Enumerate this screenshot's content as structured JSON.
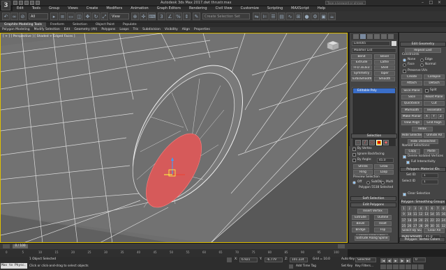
{
  "title": {
    "text": "Autodesk 3ds Max 2017.dwt  thrustr.max",
    "search_placeholder": "Type a keyword or phrase"
  },
  "menu": [
    "Edit",
    "Tools",
    "Group",
    "Views",
    "Create",
    "Modifiers",
    "Animation",
    "Graph Editors",
    "Rendering",
    "Civil View",
    "Customize",
    "Scripting",
    "MAXScript",
    "Help"
  ],
  "toolbar": {
    "selection_filter": "All",
    "reference_coord": "View",
    "named_selection": "Create Selection Set"
  },
  "ribbon_tabs": [
    "Graphite Modeling Tools",
    "Freeform",
    "Selection",
    "Object Paint",
    "Populate"
  ],
  "ribbon_items": [
    "Polygon Modeling",
    "Modify Selection",
    "Edit",
    "Geometry (All)",
    "Polygons",
    "Loops",
    "Tris",
    "Subdivision",
    "Visibility",
    "Align",
    "Properties"
  ],
  "viewport": {
    "label": "[ + ] [ Perspective ] [ Shaded + Edged Faces ]"
  },
  "command_panel": {
    "object_name": "Line005",
    "modifier_list": "Modifier List",
    "modifier_buttons": [
      "Bend",
      "Bevel",
      "Extrude",
      "Lathe",
      "FFD 3x3x3",
      "Shell",
      "Symmetry",
      "Taper",
      "TurboSmooth",
      "Smooth"
    ],
    "stack_item": "Editable Poly",
    "selection_header": "Selection",
    "by_vertex": "By Vertex",
    "ignore_backfacing": "Ignore Backfacing",
    "by_angle": "By Angle:",
    "angle_value": "45.0",
    "shrink": "Shrink",
    "grow": "Grow",
    "ring": "Ring",
    "loop": "Loop",
    "preview_selection": "Preview Selection",
    "preview_off": "Off",
    "preview_subobj": "SubObj",
    "preview_multi": "Multi",
    "selected_count": "Polygon 5538 Selected",
    "soft_selection": "Soft Selection",
    "edit_polygons": "Edit Polygons",
    "insert_vertex": "Insert Vertex",
    "extrude": "Extrude",
    "outline": "Outline",
    "bevel": "Bevel",
    "inset": "Inset",
    "bridge": "Bridge",
    "flip": "Flip",
    "hinge_from_edge": "Hinge From Edge",
    "extrude_along_spline": "Extrude Along Spline",
    "edit_triangulation": "Edit Triangulation",
    "retriangulate": "Retriangulate",
    "turn": "Turn"
  },
  "edit_geometry": {
    "header": "Edit Geometry",
    "repeat_last": "Repeat Last",
    "constraints": "Constraints",
    "none": "None",
    "edge": "Edge",
    "face": "Face",
    "normal": "Normal",
    "preserve_uvs": "Preserve UVs",
    "create": "Create",
    "collapse": "Collapse",
    "attach": "Attach",
    "detach": "Detach",
    "slice_plane": "Slice Plane",
    "split": "Split",
    "slice": "Slice",
    "reset_plane": "Reset Plane",
    "quickslice": "QuickSlice",
    "cut": "Cut",
    "msmooth": "MSmooth",
    "tessellate": "Tessellate",
    "make_planar": "Make Planar",
    "x": "X",
    "y": "Y",
    "z": "Z",
    "view_align": "View Align",
    "grid_align": "Grid Align",
    "relax": "Relax",
    "hide_selected": "Hide Selected",
    "unhide_all": "Unhide All",
    "hide_unselected": "Hide Unselected",
    "named_selections": "Named Selections:",
    "copy": "Copy",
    "paste": "Paste",
    "delete_isolated": "Delete Isolated Vertices",
    "full_interactivity": "Full Interactivity"
  },
  "material_ids": {
    "header": "Polygon: Material IDs",
    "set_id": "Set ID:",
    "set_id_value": "1",
    "select_id": "Select ID",
    "select_id_value": "1",
    "clear_selection": "Clear Selection"
  },
  "smoothing_groups": {
    "header": "Polygon: Smoothing Groups",
    "numbers": [
      "1",
      "2",
      "3",
      "4",
      "5",
      "6",
      "7",
      "8",
      "9",
      "10",
      "11",
      "12",
      "13",
      "14",
      "15",
      "16",
      "17",
      "18",
      "19",
      "20",
      "21",
      "22",
      "23",
      "24",
      "25",
      "26",
      "27",
      "28",
      "29",
      "30",
      "31",
      "32"
    ],
    "select_by_sg": "Select By SG",
    "clear_all": "Clear All",
    "auto_smooth": "Auto Smooth",
    "auto_smooth_value": "45.0"
  },
  "vertex_colors": {
    "header": "Polygon: Vertex Colors",
    "color": "Color:"
  },
  "timeline": {
    "frame": "0 / 100"
  },
  "ruler_ticks": [
    "0",
    "5",
    "10",
    "15",
    "20",
    "25",
    "30",
    "35",
    "40",
    "45",
    "50",
    "55",
    "60",
    "65",
    "70",
    "75",
    "80",
    "85",
    "90",
    "95",
    "100"
  ],
  "status": {
    "script_label": "Max to Physc.",
    "selected": "1 Object Selected",
    "prompt": "Click or click-and-drag to select objects",
    "x": "6.921",
    "y": "-6.779",
    "z": "101.224",
    "grid": "Grid = 10.0",
    "add_time_tag": "Add Time Tag",
    "auto_key": "Auto Key",
    "selected_mode": "Selected",
    "set_key": "Set Key",
    "key_filters": "Key Filters...",
    "frame": "0"
  }
}
